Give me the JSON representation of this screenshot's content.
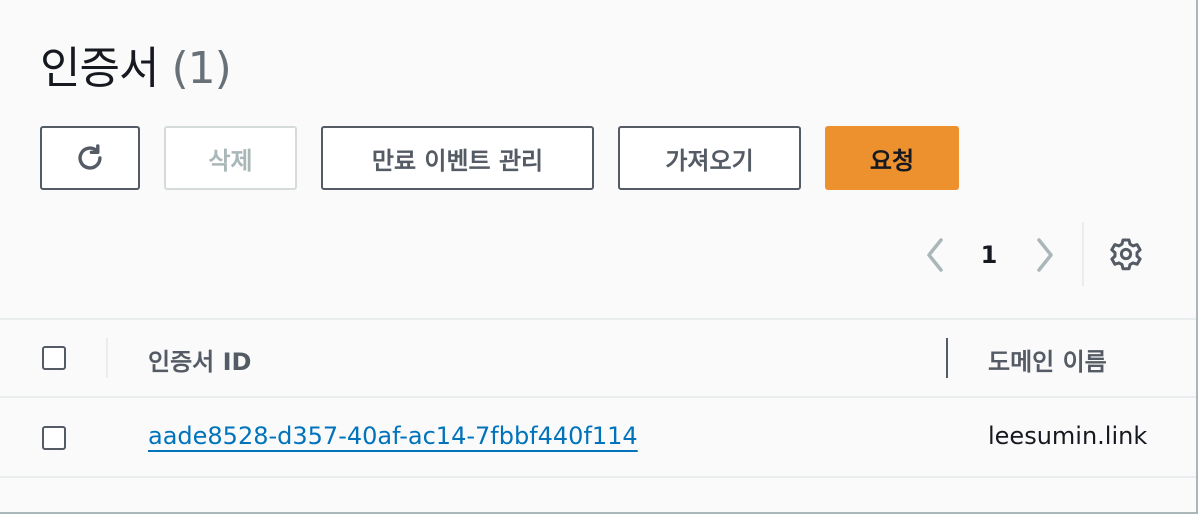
{
  "header": {
    "title": "인증서",
    "count": "(1)"
  },
  "toolbar": {
    "refresh_icon": "refresh-icon",
    "delete_label": "삭제",
    "manage_events_label": "만료 이벤트 관리",
    "import_label": "가져오기",
    "request_label": "요청",
    "primary_color": "#ec912d"
  },
  "pagination": {
    "current_page": "1",
    "prev_icon": "chevron-left-icon",
    "next_icon": "chevron-right-icon",
    "settings_icon": "gear-icon"
  },
  "table": {
    "columns": [
      "인증서 ID",
      "도메인 이름"
    ],
    "rows": [
      {
        "certificate_id": "aade8528-d357-40af-ac14-7fbbf440f114",
        "domain": "leesumin.link"
      }
    ],
    "link_color": "#0073bb"
  }
}
